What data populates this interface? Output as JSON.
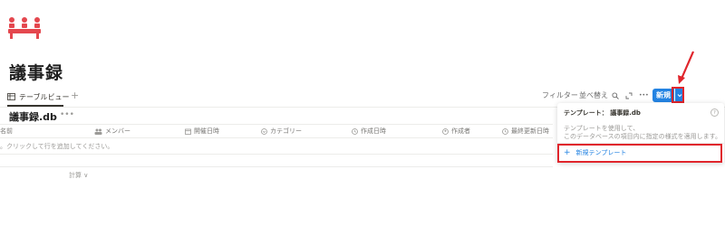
{
  "page": {
    "title": "議事録"
  },
  "view_tab": {
    "label": "テーブルビュー",
    "add": "+"
  },
  "toolbar": {
    "filter": "フィルター",
    "sort": "並べ替え",
    "more": "•••",
    "new_label": "新規"
  },
  "database": {
    "title": "議事録.db",
    "more": "•••"
  },
  "columns": [
    {
      "label": "名前",
      "icon": "title-icon"
    },
    {
      "label": "メンバー",
      "icon": "people-icon"
    },
    {
      "label": "開催日時",
      "icon": "calendar-icon"
    },
    {
      "label": "カテゴリー",
      "icon": "select-icon"
    },
    {
      "label": "作成日時",
      "icon": "clock-icon"
    },
    {
      "label": "作成者",
      "icon": "person-icon"
    },
    {
      "label": "最終更新日時",
      "icon": "clock-icon"
    }
  ],
  "table": {
    "empty_text": "。クリックして行を追加してください。",
    "calc_label": "計算 ∨"
  },
  "template_popup": {
    "title": "テンプレート： 議事録.db",
    "help": "?",
    "desc_line1": "テンプレートを使用して、",
    "desc_line2": "このデータベースの項目内に指定の様式を適用します。",
    "new_template": "新規テンプレート",
    "new_template_icon": "+"
  },
  "colors": {
    "accent": "#2383e2",
    "highlight": "#e0252c",
    "logo": "#e4474e"
  }
}
